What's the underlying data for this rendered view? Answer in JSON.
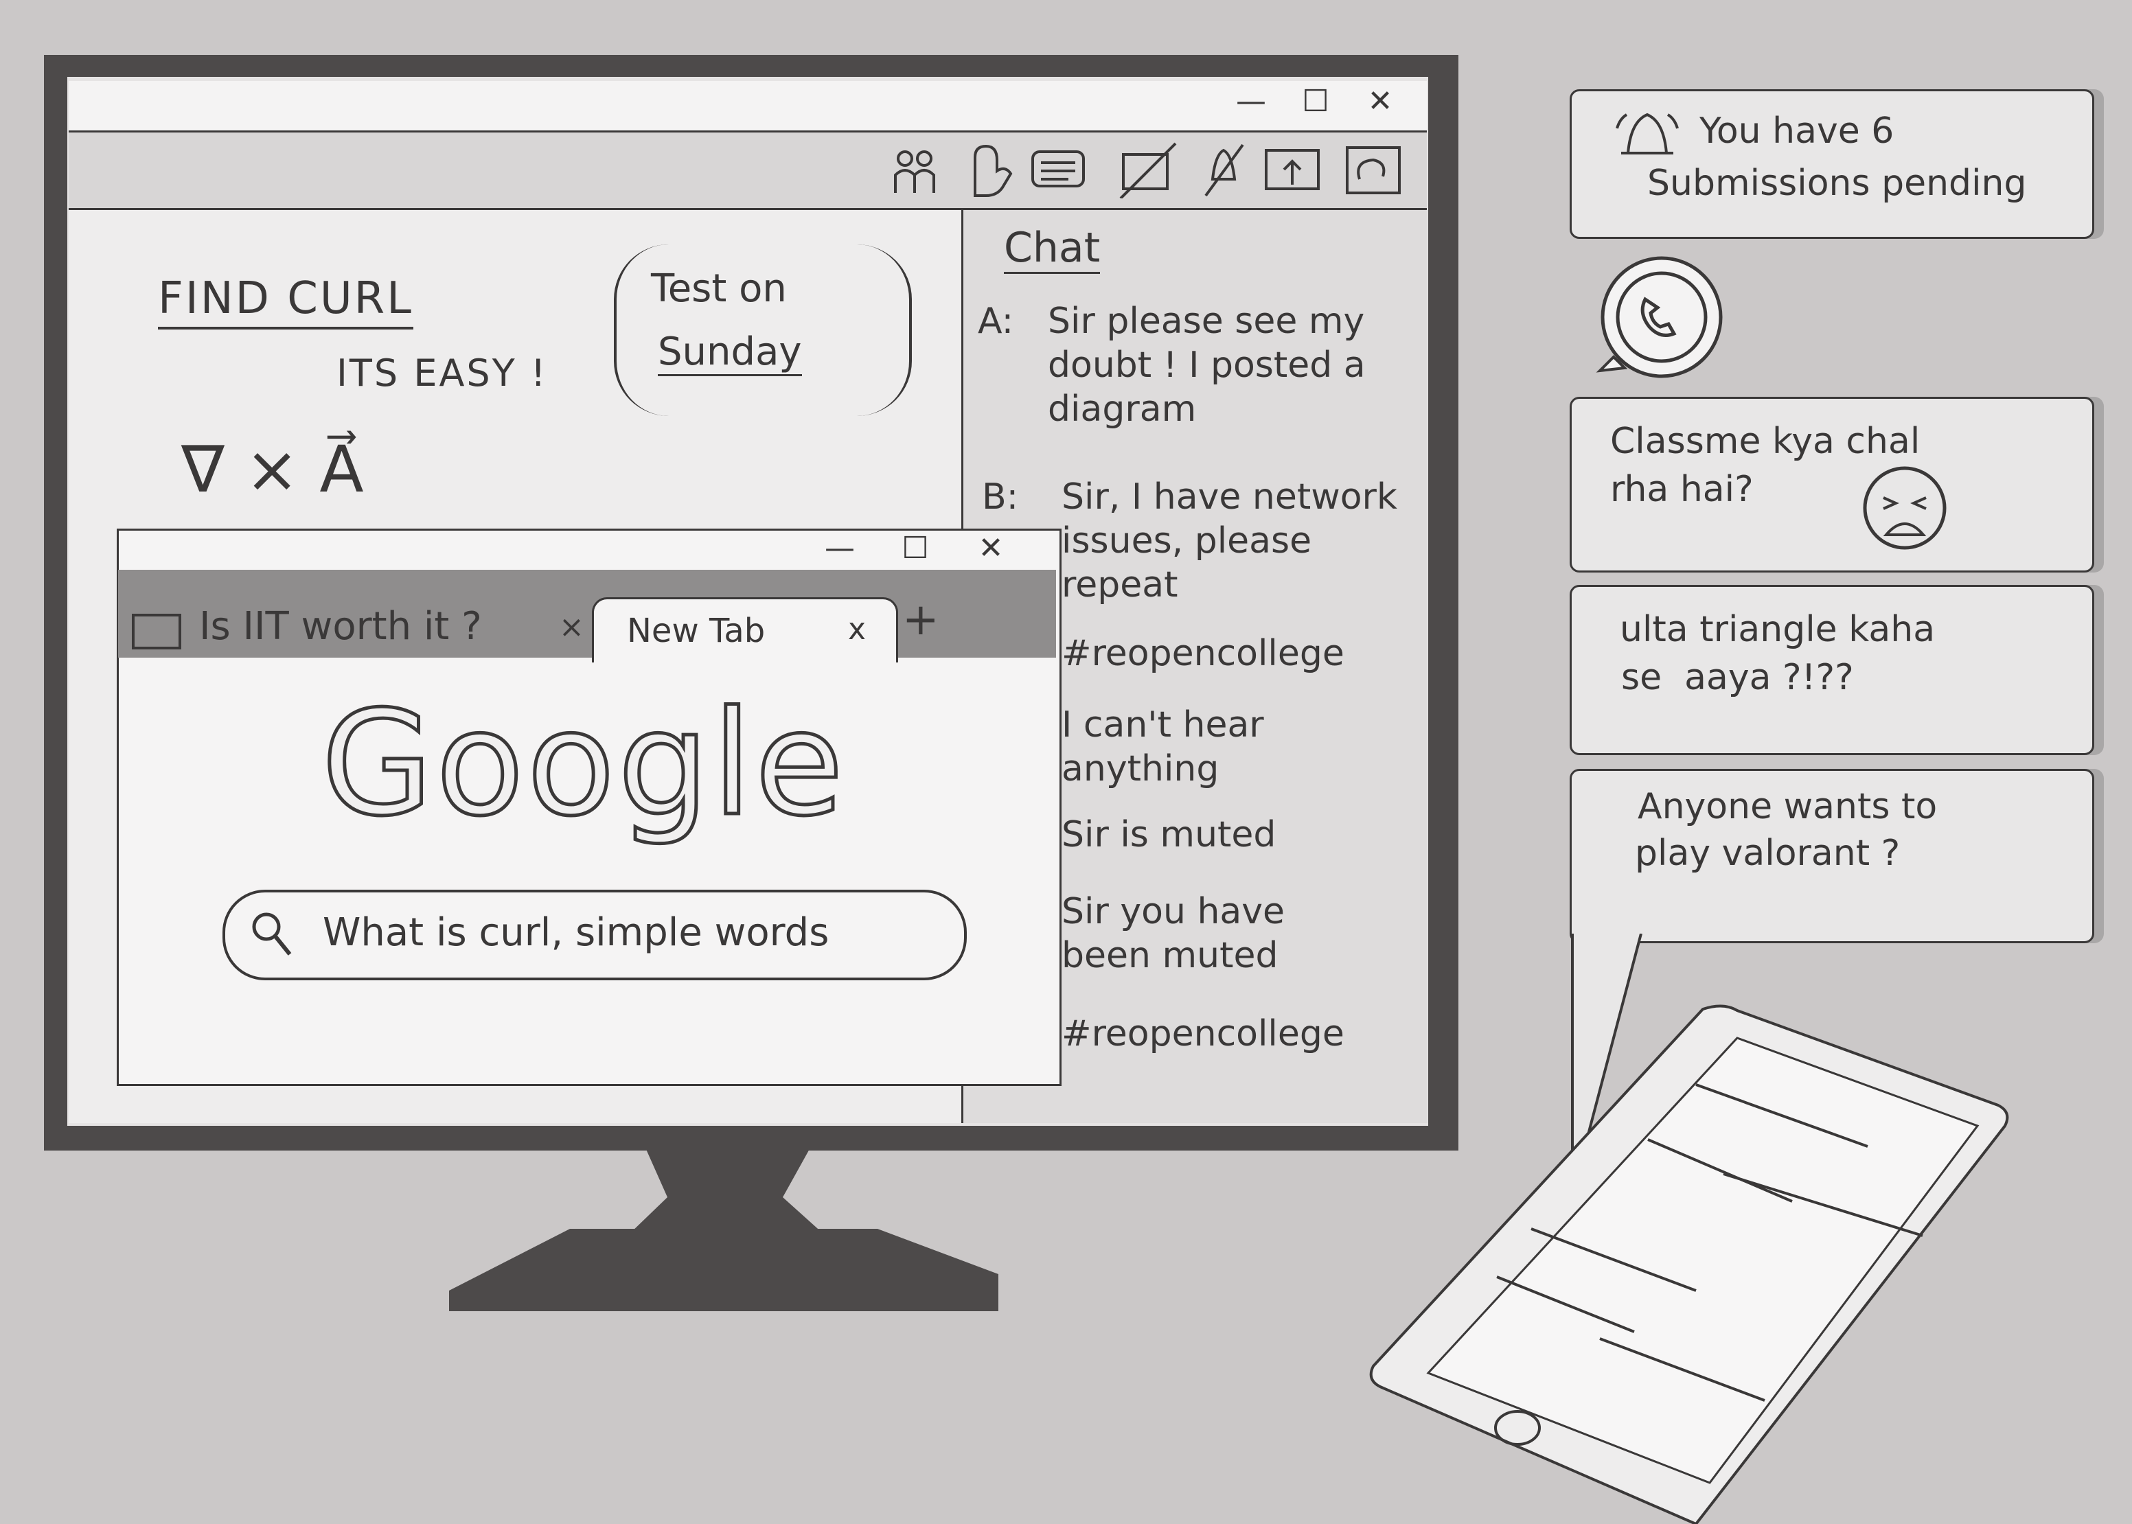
{
  "meeting_window": {
    "controls": {
      "minimize": "—",
      "maximize": "☐",
      "close": "✕"
    },
    "toolbar_icons": [
      "participants-icon",
      "hand-raise-icon",
      "chat-icon",
      "video-off-icon",
      "mic-off-icon",
      "share-screen-icon",
      "whiteboard-icon"
    ]
  },
  "whiteboard": {
    "find_curl": "FIND CURL",
    "its_easy": "ITS EASY !",
    "curl_expression": "∇ × A⃗",
    "test_line1": "Test on",
    "test_line2": "Sunday"
  },
  "chat": {
    "title": "Chat",
    "messages": [
      {
        "sender": "A:",
        "text": "Sir please see my doubt ! I posted a diagram"
      },
      {
        "sender": "B:",
        "text": "Sir, I have network issues, please repeat"
      },
      {
        "sender": "",
        "text": "#reopencollege"
      },
      {
        "sender": "",
        "text": "I can't hear anything"
      },
      {
        "sender": "",
        "text": "Sir is muted"
      },
      {
        "sender": "",
        "text": "Sir you have been muted"
      },
      {
        "sender": "",
        "text": "#reopencollege"
      }
    ]
  },
  "browser": {
    "controls": {
      "minimize": "—",
      "maximize": "☐",
      "close": "✕"
    },
    "tabs": [
      {
        "label": "Is IIT worth it ?",
        "close": "×"
      },
      {
        "label": "New Tab",
        "close": "x"
      }
    ],
    "new_tab": "+",
    "logo": "Google",
    "search_value": "What is curl, simple words"
  },
  "notifications": [
    {
      "text_line1": "You have 6",
      "text_line2": "Submissions pending",
      "icon": "bell-icon"
    },
    {
      "text_line1": "Classme kya chal",
      "text_line2": "rha hai?",
      "icon": "crying-face-icon"
    },
    {
      "text_line1": "ulta triangle kaha",
      "text_line2": "se  aaya ?!??"
    },
    {
      "text_line1": "Anyone wants to",
      "text_line2": "play valorant ?"
    }
  ],
  "whatsapp_icon": "whatsapp-icon",
  "colors": {
    "background": "#cbc8c8",
    "bezel": "#4d4a4a",
    "ink": "#3a3838",
    "panel": "#e6e4e4"
  }
}
